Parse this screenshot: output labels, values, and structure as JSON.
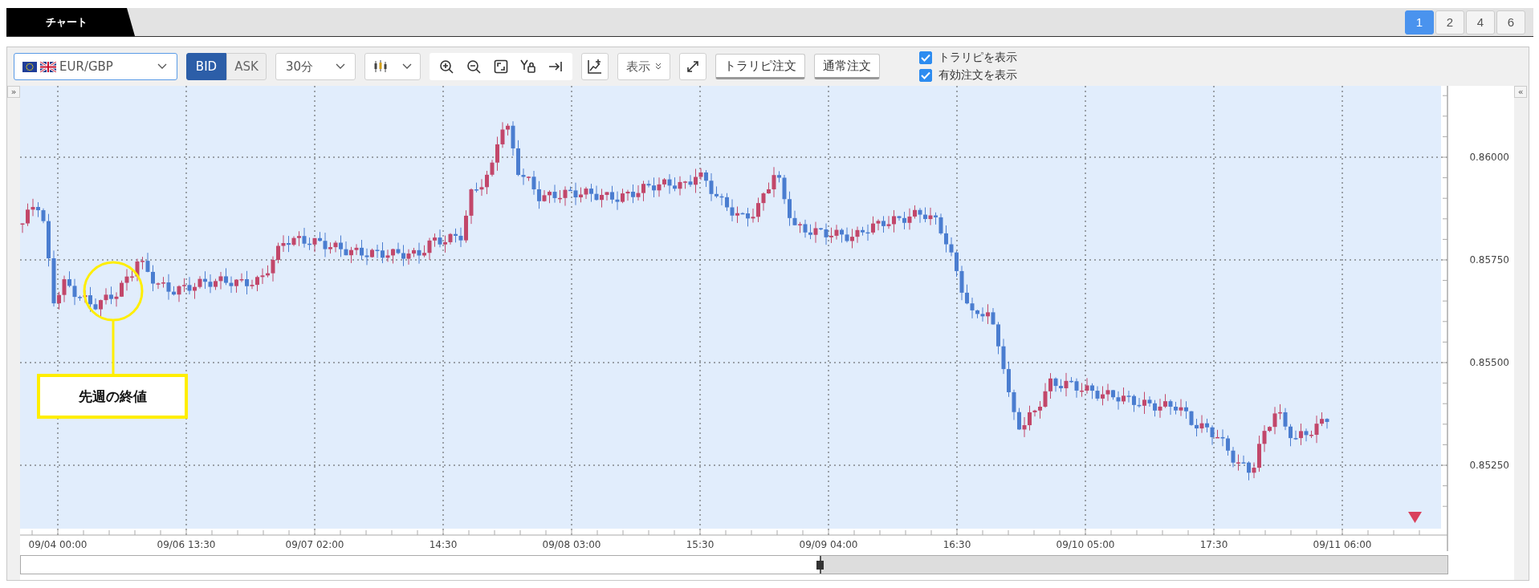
{
  "tabs": [
    {
      "label": "チャート",
      "selected": true
    }
  ],
  "layout_buttons": [
    {
      "label": "1",
      "selected": true
    },
    {
      "label": "2",
      "selected": false
    },
    {
      "label": "4",
      "selected": false
    },
    {
      "label": "6",
      "selected": false
    }
  ],
  "toolbar": {
    "pair": "EUR/GBP",
    "price_side": [
      {
        "label": "BID",
        "selected": true
      },
      {
        "label": "ASK",
        "selected": false
      }
    ],
    "interval": "30分",
    "display_menu": "表示",
    "buttons": [
      "トラリピ注文",
      "通常注文"
    ],
    "options": [
      {
        "label": "トラリピを表示",
        "checked": true
      },
      {
        "label": "有効注文を表示",
        "checked": true
      }
    ]
  },
  "chart": {
    "left_toggle": "»",
    "right_toggle": "«",
    "y_labels": [
      "0.86000",
      "0.85750",
      "0.85500",
      "0.85250"
    ],
    "x_labels": [
      "09/04 00:00",
      "09/06 13:30",
      "09/07 02:00",
      "14:30",
      "09/08 03:00",
      "15:30",
      "09/09 04:00",
      "16:30",
      "09/10 05:00",
      "17:30",
      "09/11 06:00"
    ],
    "annotation": "先週の終値"
  }
}
